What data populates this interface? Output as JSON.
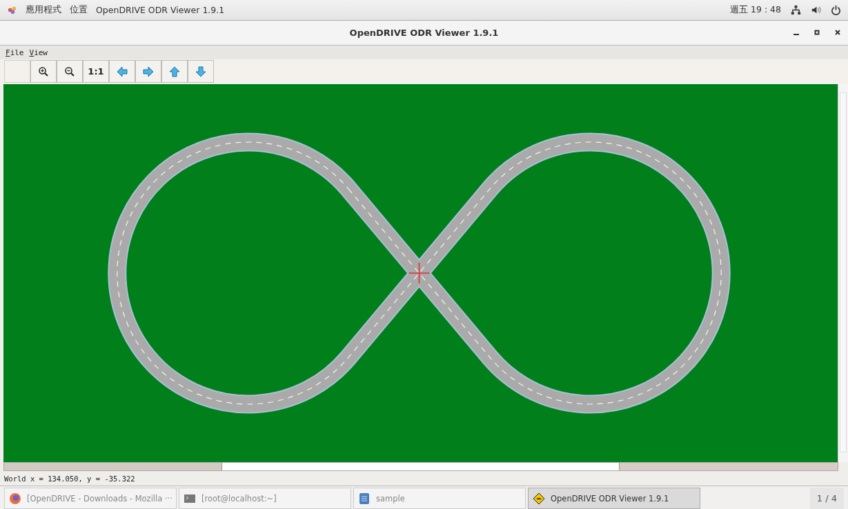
{
  "top_bar": {
    "apps_menu": "應用程式",
    "places_menu": "位置",
    "active_app": "OpenDRIVE ODR Viewer 1.9.1",
    "clock": "週五 19 : 48"
  },
  "window": {
    "title": "OpenDRIVE ODR Viewer 1.9.1"
  },
  "menu": [
    {
      "label": "File"
    },
    {
      "label": "View"
    }
  ],
  "toolbar": [
    {
      "kind": "zoom-in"
    },
    {
      "kind": "zoom-out"
    },
    {
      "kind": "text",
      "label": "1:1"
    },
    {
      "kind": "left"
    },
    {
      "kind": "right"
    },
    {
      "kind": "up"
    },
    {
      "kind": "down"
    }
  ],
  "status_bar": {
    "text": "World x = 134.050, y = -35.322"
  },
  "taskbar": {
    "items": [
      {
        "kind": "browser",
        "label": "[OpenDRIVE - Downloads - Mozilla ···",
        "selected": false
      },
      {
        "kind": "terminal",
        "label": "[root@localhost:~]",
        "selected": false
      },
      {
        "kind": "file",
        "label": "sample",
        "selected": false
      },
      {
        "kind": "road",
        "label": "OpenDRIVE ODR Viewer 1.9.1",
        "selected": true
      }
    ],
    "pager": "1 / 4"
  }
}
